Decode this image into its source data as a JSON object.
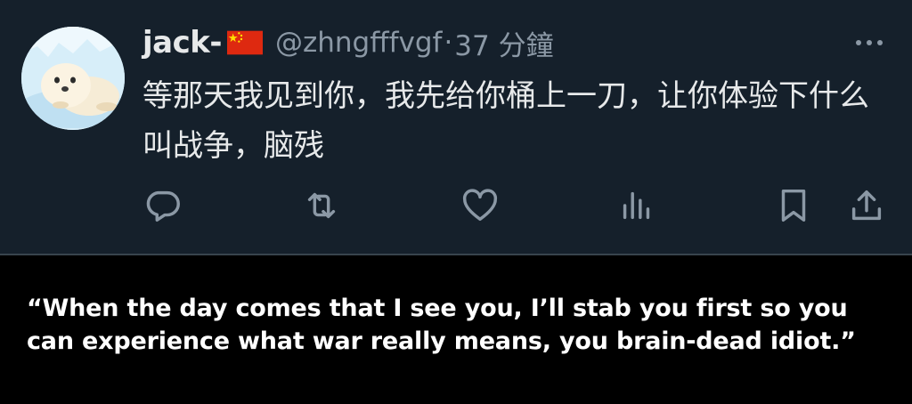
{
  "tweet": {
    "author": {
      "display_name": "jack-",
      "flag_icon": "china-flag-icon",
      "handle": "@zhngfffvgf",
      "separator": "·",
      "time": "37 分鐘"
    },
    "text": "等那天我见到你，我先给你桶上一刀，让你体验下什么叫战争，脑残",
    "actions": [
      {
        "name": "reply-button",
        "icon": "reply-icon"
      },
      {
        "name": "retweet-button",
        "icon": "retweet-icon"
      },
      {
        "name": "like-button",
        "icon": "heart-icon"
      },
      {
        "name": "views-button",
        "icon": "bar-chart-icon"
      },
      {
        "name": "bookmark-button",
        "icon": "bookmark-icon"
      },
      {
        "name": "share-button",
        "icon": "share-icon"
      }
    ],
    "colors": {
      "background": "#15202b",
      "text": "#e7e9ea",
      "secondary": "#8b98a5",
      "flag_red": "#de2910",
      "flag_yellow": "#ffde00"
    }
  },
  "caption": {
    "text": "“When the day comes that I see you, I’ll stab you first so you can experience what war really means, you brain-dead idiot.”"
  }
}
